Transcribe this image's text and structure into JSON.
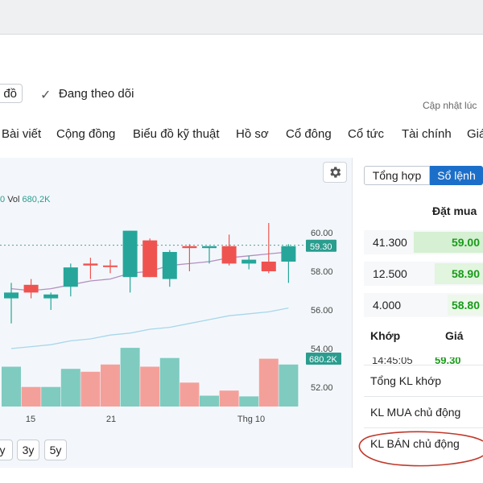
{
  "header": {
    "chart_button_partial": "đồ",
    "follow_label": "Đang theo dõi",
    "updated_label": "Cập nhật lúc"
  },
  "nav": {
    "items": [
      "Bài viết",
      "Cộng đồng",
      "Biểu đồ kỹ thuật",
      "Hồ sơ",
      "Cổ đông",
      "Cổ tức",
      "Tài chính",
      "Giá"
    ]
  },
  "chart": {
    "legend_partial": "0",
    "legend_vol_label": "Vol",
    "legend_vol_value": "680,2K",
    "price_ticks": [
      "60.00",
      "58.00",
      "56.00",
      "54.00",
      "52.00"
    ],
    "last_price": "59.30",
    "last_volume": "680.2K",
    "x_labels": [
      "15",
      "21",
      "Thg 10"
    ],
    "range_buttons": [
      "y",
      "3y",
      "5y"
    ],
    "colors": {
      "up": "#26a69a",
      "down": "#ef5350",
      "vol_up": "#7fcbc0",
      "vol_down": "#f4a09a",
      "ma1": "#b38fbf",
      "ma2": "#a8d6ea"
    }
  },
  "chart_data": {
    "type": "candlestick",
    "ylim": [
      51.5,
      61
    ],
    "candles": [
      {
        "o": 56.9,
        "h": 57.4,
        "l": 55.3,
        "c": 56.6,
        "dir": "up"
      },
      {
        "o": 57.3,
        "h": 57.6,
        "l": 56.6,
        "c": 56.9,
        "dir": "down"
      },
      {
        "o": 56.6,
        "h": 56.9,
        "l": 56.0,
        "c": 56.8,
        "dir": "up"
      },
      {
        "o": 57.2,
        "h": 58.4,
        "l": 56.7,
        "c": 58.2,
        "dir": "up"
      },
      {
        "o": 58.4,
        "h": 58.7,
        "l": 57.6,
        "c": 58.3,
        "dir": "down"
      },
      {
        "o": 58.3,
        "h": 58.6,
        "l": 57.9,
        "c": 58.3,
        "dir": "down"
      },
      {
        "o": 57.7,
        "h": 60.1,
        "l": 56.9,
        "c": 60.1,
        "dir": "up"
      },
      {
        "o": 59.6,
        "h": 59.7,
        "l": 57.7,
        "c": 57.7,
        "dir": "down"
      },
      {
        "o": 57.6,
        "h": 59.1,
        "l": 57.2,
        "c": 59.0,
        "dir": "up"
      },
      {
        "o": 59.3,
        "h": 59.4,
        "l": 58.0,
        "c": 59.2,
        "dir": "down"
      },
      {
        "o": 59.3,
        "h": 59.3,
        "l": 58.4,
        "c": 59.2,
        "dir": "up"
      },
      {
        "o": 59.3,
        "h": 59.9,
        "l": 58.3,
        "c": 58.4,
        "dir": "down"
      },
      {
        "o": 58.4,
        "h": 58.8,
        "l": 58.1,
        "c": 58.6,
        "dir": "up"
      },
      {
        "o": 58.5,
        "h": 60.5,
        "l": 57.9,
        "c": 58.0,
        "dir": "down"
      },
      {
        "o": 58.5,
        "h": 59.4,
        "l": 57.4,
        "c": 59.3,
        "dir": "up"
      }
    ],
    "volumes": [
      {
        "v": 0.55,
        "dir": "up"
      },
      {
        "v": 0.27,
        "dir": "down"
      },
      {
        "v": 0.27,
        "dir": "up"
      },
      {
        "v": 0.52,
        "dir": "up"
      },
      {
        "v": 0.48,
        "dir": "down"
      },
      {
        "v": 0.58,
        "dir": "down"
      },
      {
        "v": 0.81,
        "dir": "up"
      },
      {
        "v": 0.55,
        "dir": "down"
      },
      {
        "v": 0.67,
        "dir": "up"
      },
      {
        "v": 0.33,
        "dir": "down"
      },
      {
        "v": 0.15,
        "dir": "up"
      },
      {
        "v": 0.22,
        "dir": "down"
      },
      {
        "v": 0.14,
        "dir": "up"
      },
      {
        "v": 0.66,
        "dir": "down"
      },
      {
        "v": 0.58,
        "dir": "up"
      }
    ],
    "ma_short": [
      57.1,
      57.0,
      57.1,
      57.3,
      57.5,
      57.6,
      57.9,
      58.0,
      58.3,
      58.4,
      58.5,
      58.7,
      58.8,
      58.9,
      59.0
    ],
    "ma_long": [
      54.0,
      54.1,
      54.2,
      54.4,
      54.5,
      54.7,
      54.8,
      55.0,
      55.1,
      55.3,
      55.5,
      55.7,
      55.8,
      55.9,
      56.1
    ],
    "reference_price": 59.3
  },
  "orderbook": {
    "tabs": [
      "Tổng hợp",
      "Sổ lệnh"
    ],
    "bid_header": "Đặt mua",
    "rows": [
      {
        "volume": "41.300",
        "price": "59.00"
      },
      {
        "volume": "12.500",
        "price": "58.90"
      },
      {
        "volume": "4.000",
        "price": "58.80"
      }
    ],
    "match_headers": [
      "Khớp",
      "Giá"
    ],
    "match_partial_time": "14:45:05",
    "match_partial_price": "59.30"
  },
  "stats": {
    "items": [
      "Tổng KL khớp",
      "KL MUA chủ động",
      "KL BÁN chủ động"
    ]
  },
  "annotation": {
    "color": "#c0392b"
  }
}
